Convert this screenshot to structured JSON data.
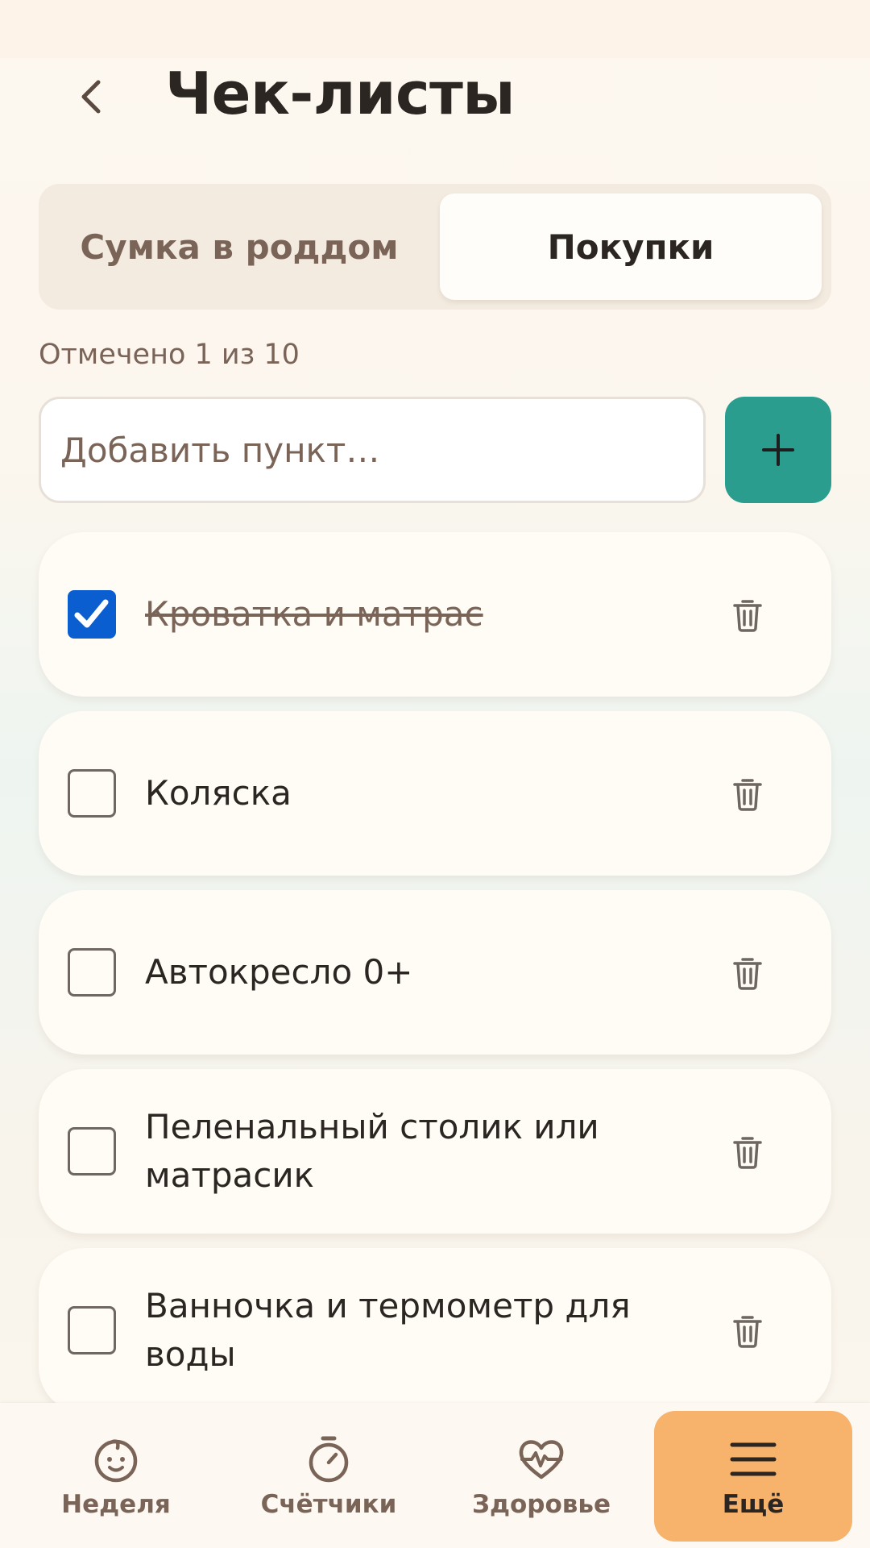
{
  "header": {
    "title": "Чек-листы",
    "back_icon": "chevron-left-icon"
  },
  "tabs": [
    {
      "label": "Сумка в роддом",
      "active": false
    },
    {
      "label": "Покупки",
      "active": true
    }
  ],
  "counter_text": "Отмечено 1 из 10",
  "add_item": {
    "placeholder": "Добавить пункт…",
    "value": "",
    "button_icon": "plus-icon"
  },
  "items": [
    {
      "label": "Кроватка и матрас",
      "checked": true
    },
    {
      "label": "Коляска",
      "checked": false
    },
    {
      "label": "Автокресло 0+",
      "checked": false
    },
    {
      "label": "Пеленальный столик или матрасик",
      "checked": false
    },
    {
      "label": "Ванночка и термометр для воды",
      "checked": false
    }
  ],
  "nav": [
    {
      "label": "Неделя",
      "icon": "baby-face-icon",
      "active": false
    },
    {
      "label": "Счётчики",
      "icon": "stopwatch-icon",
      "active": false
    },
    {
      "label": "Здоровье",
      "icon": "heart-pulse-icon",
      "active": false
    },
    {
      "label": "Ещё",
      "icon": "menu-icon",
      "active": true
    }
  ],
  "colors": {
    "accent_teal": "#2a9d8f",
    "accent_orange": "#f7b26b",
    "checkbox_blue": "#0a5ecf",
    "text_dark": "#2b2622",
    "text_muted": "#7a6458"
  }
}
